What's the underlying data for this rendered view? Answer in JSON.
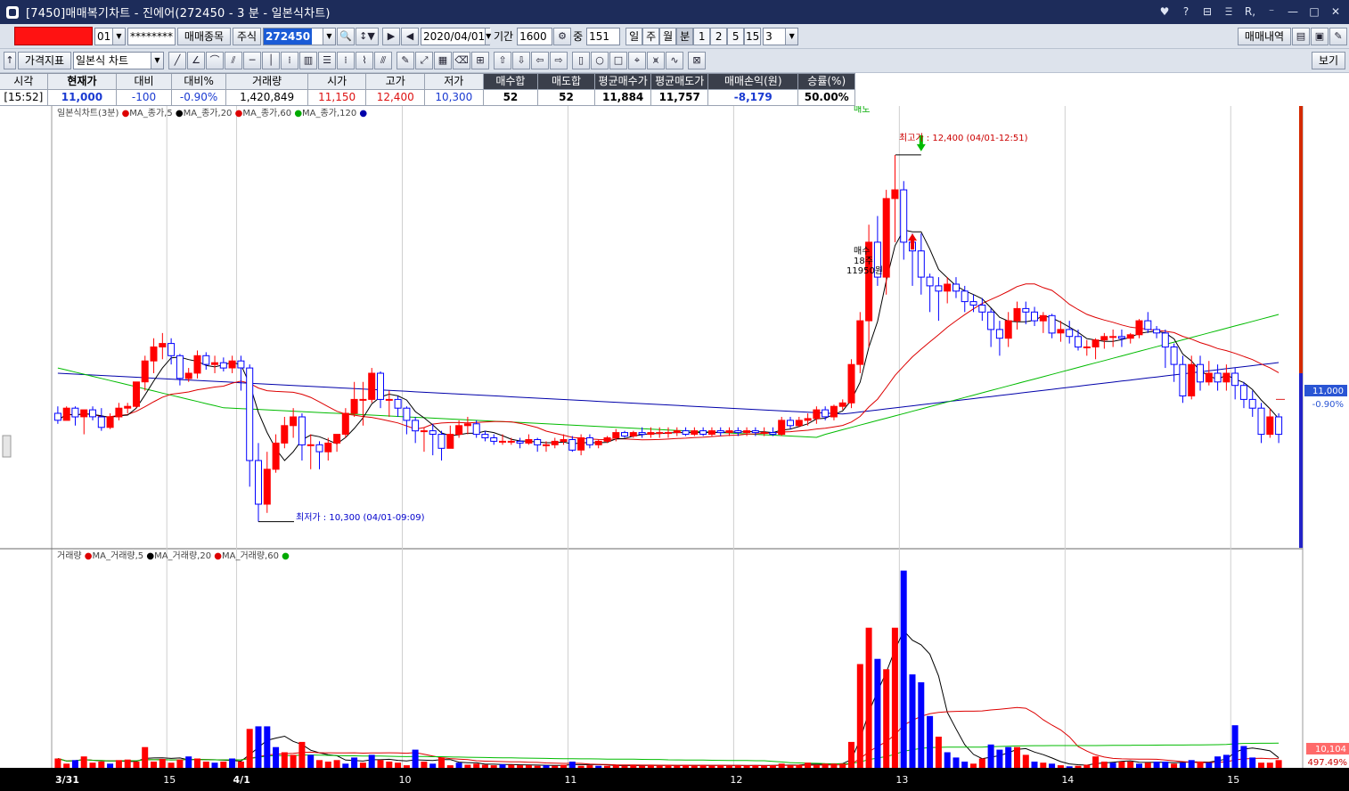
{
  "window": {
    "title": "[7450]매매복기차트 - 진에어(272450 - 3 분 - 일본식차트)",
    "controls": [
      "♥",
      "?",
      "⊟",
      "Ⲷ",
      "R,",
      "⁻",
      "—",
      "□",
      "✕"
    ]
  },
  "toolbar1": {
    "account_num": "01",
    "password": "********",
    "trade_items_label": "매매종목",
    "market_label": "주식",
    "code_value": "272450",
    "date_value": "2020/04/01",
    "period_label": "기간",
    "period_value": "1600",
    "mid_label": "중",
    "count_value": "151",
    "periods": [
      "일",
      "주",
      "월",
      "분",
      "1",
      "2",
      "5",
      "15",
      "3"
    ],
    "trade_history_label": "매매내역"
  },
  "toolbar2": {
    "price_indicator_label": "가격지표",
    "chart_type_value": "일본식 차트",
    "view_label": "보기"
  },
  "info": {
    "headers": [
      "시각",
      "현재가",
      "대비",
      "대비%",
      "거래량",
      "시가",
      "고가",
      "저가",
      "매수합",
      "매도합",
      "평균매수가",
      "평균매도가",
      "매매손익(원)",
      "승률(%)"
    ],
    "values": [
      "[15:52]",
      "11,000",
      "-100",
      "-0.90%",
      "1,420,849",
      "11,150",
      "12,400",
      "10,300",
      "52",
      "52",
      "11,884",
      "11,757",
      "-8,179",
      "50.00%"
    ]
  },
  "colors": {
    "up": "#ff0000",
    "down": "#0000ff",
    "ma5": "#000000",
    "ma20": "#dd0000",
    "ma60": "#00bb00",
    "ma120": "#0000aa",
    "titlebar": "#1d2c5a"
  },
  "chart_data": {
    "type": "candlestick",
    "price_panel": {
      "legend": [
        "일본식차트(3분)",
        "MA_종가,5",
        "MA_종가,20",
        "MA_종가,60",
        "MA_종가,120"
      ],
      "y_range": [
        10150,
        12680
      ],
      "high_annotation": "최고가 : 12,400 (04/01-12:51)",
      "low_annotation": "최저가 : 10,300 (04/01-09:09)",
      "sell_marker": "매도",
      "buy_marker": [
        "매수",
        "18주",
        "11950원"
      ],
      "current_price": "11,000",
      "current_change": "-0.90%",
      "candles": [
        [
          10920,
          10960,
          10860,
          10880
        ],
        [
          10880,
          10960,
          10880,
          10950
        ],
        [
          10950,
          10960,
          10850,
          10900
        ],
        [
          10900,
          10940,
          10800,
          10940
        ],
        [
          10940,
          10960,
          10880,
          10900
        ],
        [
          10900,
          10950,
          10820,
          10840
        ],
        [
          10840,
          10920,
          10830,
          10900
        ],
        [
          10900,
          10980,
          10880,
          10950
        ],
        [
          10950,
          10980,
          10920,
          10960
        ],
        [
          10960,
          11100,
          10950,
          11100
        ],
        [
          11100,
          11250,
          11050,
          11220
        ],
        [
          11220,
          11350,
          11150,
          11300
        ],
        [
          11300,
          11380,
          11230,
          11320
        ],
        [
          11320,
          11350,
          11200,
          11250
        ],
        [
          11250,
          11260,
          11080,
          11120
        ],
        [
          11120,
          11180,
          11100,
          11150
        ],
        [
          11150,
          11280,
          11120,
          11250
        ],
        [
          11250,
          11270,
          11170,
          11200
        ],
        [
          11200,
          11250,
          11150,
          11210
        ],
        [
          11210,
          11240,
          11160,
          11180
        ],
        [
          11180,
          11250,
          11150,
          11220
        ],
        [
          11220,
          11250,
          11050,
          11180
        ],
        [
          11180,
          11200,
          10500,
          10650
        ],
        [
          10650,
          10750,
          10300,
          10400
        ],
        [
          10400,
          10700,
          10350,
          10600
        ],
        [
          10600,
          10800,
          10580,
          10750
        ],
        [
          10750,
          10900,
          10720,
          10850
        ],
        [
          10850,
          10950,
          10780,
          10900
        ],
        [
          10900,
          10920,
          10650,
          10740
        ],
        [
          10740,
          10800,
          10600,
          10740
        ],
        [
          10740,
          10760,
          10600,
          10700
        ],
        [
          10700,
          10780,
          10650,
          10750
        ],
        [
          10750,
          10800,
          10700,
          10800
        ],
        [
          10800,
          10950,
          10780,
          10920
        ],
        [
          10920,
          11100,
          10900,
          11000
        ],
        [
          11000,
          11100,
          10850,
          11000
        ],
        [
          11000,
          11180,
          10980,
          11150
        ],
        [
          11150,
          11160,
          10950,
          11000
        ],
        [
          11000,
          11050,
          10900,
          11000
        ],
        [
          11000,
          11020,
          10900,
          10950
        ],
        [
          10950,
          10960,
          10800,
          10880
        ],
        [
          10880,
          10900,
          10750,
          10820
        ],
        [
          10820,
          10840,
          10700,
          10820
        ],
        [
          10820,
          10860,
          10680,
          10800
        ],
        [
          10800,
          10820,
          10650,
          10720
        ],
        [
          10720,
          10850,
          10720,
          10800
        ],
        [
          10800,
          10880,
          10780,
          10850
        ],
        [
          10850,
          10900,
          10800,
          10860
        ],
        [
          10860,
          10880,
          10780,
          10800
        ],
        [
          10800,
          10820,
          10760,
          10780
        ],
        [
          10780,
          10800,
          10740,
          10760
        ],
        [
          10760,
          10800,
          10740,
          10760
        ],
        [
          10760,
          10780,
          10740,
          10760
        ],
        [
          10760,
          10780,
          10720,
          10750
        ],
        [
          10750,
          10800,
          10740,
          10770
        ],
        [
          10770,
          10780,
          10700,
          10740
        ],
        [
          10740,
          10760,
          10700,
          10740
        ],
        [
          10740,
          10780,
          10720,
          10760
        ],
        [
          10760,
          10800,
          10740,
          10770
        ],
        [
          10770,
          10790,
          10700,
          10710
        ],
        [
          10710,
          10800,
          10680,
          10780
        ],
        [
          10780,
          10800,
          10720,
          10740
        ],
        [
          10740,
          10770,
          10720,
          10760
        ],
        [
          10760,
          10790,
          10750,
          10780
        ],
        [
          10780,
          10830,
          10760,
          10810
        ],
        [
          10810,
          10820,
          10780,
          10790
        ],
        [
          10790,
          10820,
          10780,
          10810
        ],
        [
          10810,
          10840,
          10780,
          10800
        ],
        [
          10800,
          10840,
          10780,
          10810
        ],
        [
          10810,
          10840,
          10780,
          10810
        ],
        [
          10810,
          10840,
          10780,
          10810
        ],
        [
          10810,
          10840,
          10790,
          10820
        ],
        [
          10820,
          10840,
          10790,
          10800
        ],
        [
          10800,
          10840,
          10790,
          10820
        ],
        [
          10820,
          10840,
          10790,
          10800
        ],
        [
          10800,
          10840,
          10790,
          10820
        ],
        [
          10820,
          10840,
          10790,
          10810
        ],
        [
          10810,
          10840,
          10790,
          10820
        ],
        [
          10820,
          10840,
          10790,
          10810
        ],
        [
          10810,
          10840,
          10790,
          10820
        ],
        [
          10820,
          10840,
          10790,
          10810
        ],
        [
          10810,
          10840,
          10790,
          10810
        ],
        [
          10810,
          10840,
          10790,
          10800
        ],
        [
          10800,
          10900,
          10790,
          10880
        ],
        [
          10880,
          10900,
          10830,
          10850
        ],
        [
          10850,
          10900,
          10840,
          10880
        ],
        [
          10880,
          10920,
          10850,
          10890
        ],
        [
          10890,
          10960,
          10860,
          10940
        ],
        [
          10940,
          10960,
          10880,
          10900
        ],
        [
          10900,
          10970,
          10880,
          10960
        ],
        [
          10960,
          11000,
          10940,
          10980
        ],
        [
          10980,
          11230,
          10950,
          11200
        ],
        [
          11200,
          11500,
          11150,
          11450
        ],
        [
          11450,
          12000,
          11300,
          11900
        ],
        [
          11900,
          12050,
          11650,
          11700
        ],
        [
          11700,
          12200,
          11600,
          12150
        ],
        [
          12150,
          12400,
          11900,
          12200
        ],
        [
          12200,
          12250,
          11800,
          11900
        ],
        [
          11900,
          11950,
          11650,
          11850
        ],
        [
          11850,
          11950,
          11600,
          11700
        ],
        [
          11700,
          11720,
          11500,
          11650
        ],
        [
          11650,
          11700,
          11450,
          11620
        ],
        [
          11620,
          11700,
          11550,
          11660
        ],
        [
          11660,
          11700,
          11580,
          11620
        ],
        [
          11620,
          11650,
          11500,
          11560
        ],
        [
          11560,
          11600,
          11500,
          11540
        ],
        [
          11540,
          11580,
          11450,
          11500
        ],
        [
          11500,
          11520,
          11300,
          11400
        ],
        [
          11400,
          11450,
          11250,
          11350
        ],
        [
          11350,
          11500,
          11300,
          11450
        ],
        [
          11450,
          11560,
          11400,
          11520
        ],
        [
          11520,
          11560,
          11430,
          11500
        ],
        [
          11500,
          11530,
          11420,
          11450
        ],
        [
          11450,
          11500,
          11380,
          11480
        ],
        [
          11480,
          11490,
          11350,
          11380
        ],
        [
          11380,
          11450,
          11330,
          11400
        ],
        [
          11400,
          11450,
          11320,
          11360
        ],
        [
          11360,
          11400,
          11280,
          11300
        ],
        [
          11300,
          11340,
          11250,
          11300
        ],
        [
          11300,
          11350,
          11230,
          11340
        ],
        [
          11340,
          11380,
          11290,
          11360
        ],
        [
          11360,
          11400,
          11300,
          11360
        ],
        [
          11360,
          11400,
          11300,
          11350
        ],
        [
          11350,
          11380,
          11320,
          11370
        ],
        [
          11370,
          11460,
          11350,
          11450
        ],
        [
          11450,
          11500,
          11380,
          11400
        ],
        [
          11400,
          11420,
          11350,
          11380
        ],
        [
          11380,
          11400,
          11180,
          11300
        ],
        [
          11300,
          11320,
          11100,
          11200
        ],
        [
          11200,
          11250,
          10980,
          11020
        ],
        [
          11020,
          11250,
          11000,
          11200
        ],
        [
          11200,
          11250,
          11050,
          11100
        ],
        [
          11100,
          11220,
          11080,
          11150
        ],
        [
          11150,
          11200,
          11050,
          11100
        ],
        [
          11100,
          11200,
          11050,
          11150
        ],
        [
          11150,
          11180,
          11000,
          11080
        ],
        [
          11080,
          11100,
          10950,
          11000
        ],
        [
          11000,
          11050,
          10900,
          10950
        ],
        [
          10950,
          10980,
          10750,
          10800
        ],
        [
          10800,
          10950,
          10780,
          10900
        ],
        [
          10900,
          10920,
          10750,
          10800
        ]
      ]
    },
    "volume_panel": {
      "legend": [
        "거래량",
        "MA_거래량,5",
        "MA_거래량,20",
        "MA_거래량,60"
      ],
      "max": 400000,
      "current_volume": "10,104",
      "current_ratio": "497.49%",
      "volumes": [
        18000,
        8000,
        15000,
        22000,
        10000,
        12000,
        8000,
        15000,
        16000,
        12000,
        40000,
        12000,
        17000,
        10000,
        16000,
        22000,
        18000,
        12000,
        10000,
        12000,
        18000,
        12000,
        75000,
        80000,
        80000,
        40000,
        30000,
        25000,
        50000,
        25000,
        15000,
        12000,
        15000,
        8000,
        20000,
        10000,
        25000,
        15000,
        12000,
        10000,
        5000,
        35000,
        12000,
        8000,
        20000,
        5000,
        10000,
        6000,
        8000,
        6000,
        5000,
        7000,
        6000,
        5000,
        5000,
        4000,
        5000,
        4000,
        6000,
        12000,
        4000,
        5000,
        4000,
        4000,
        5000,
        4000,
        5000,
        4000,
        5000,
        4000,
        5000,
        4000,
        5000,
        4000,
        5000,
        4000,
        5000,
        4000,
        5000,
        4000,
        5000,
        4000,
        5000,
        8000,
        5000,
        6000,
        10000,
        6000,
        8000,
        8000,
        8000,
        50000,
        200000,
        270000,
        210000,
        190000,
        270000,
        380000,
        180000,
        165000,
        100000,
        60000,
        30000,
        20000,
        12000,
        8000,
        18000,
        45000,
        35000,
        40000,
        40000,
        25000,
        12000,
        10000,
        8000,
        5000,
        3000,
        4000,
        6000,
        22000,
        12000,
        10000,
        12000,
        12000,
        8000,
        10000,
        12000,
        12000,
        8000,
        10000,
        15000,
        12000,
        10000,
        22000,
        25000,
        82000,
        42000,
        20000,
        10000,
        10000,
        15000,
        12000,
        12000,
        10000,
        20000,
        12000,
        10000,
        22000,
        18000,
        15000,
        25000,
        10000
      ],
      "volume_dir": [
        1,
        1,
        0,
        1,
        1,
        1,
        0,
        1,
        1,
        1,
        1,
        1,
        1,
        1,
        1,
        0,
        1,
        1,
        0,
        1,
        0,
        1,
        1,
        0,
        0,
        0,
        1,
        1,
        1,
        0,
        1,
        1,
        1,
        0,
        0,
        1,
        0,
        1,
        1,
        1,
        1,
        0,
        1,
        0,
        1,
        1,
        0,
        1,
        1,
        1,
        1,
        0,
        1,
        1,
        1,
        1,
        0,
        1,
        1,
        0,
        1,
        1,
        0,
        1,
        1,
        1,
        1,
        1,
        1,
        1,
        1,
        1,
        1,
        1,
        1,
        1,
        1,
        1,
        1,
        1,
        1,
        1,
        1,
        1,
        1,
        1,
        1,
        1,
        1,
        1,
        1,
        1,
        1,
        1,
        0,
        1,
        1,
        0,
        0,
        0,
        0,
        1,
        0,
        0,
        0,
        1,
        1,
        0,
        0,
        0,
        1,
        1,
        0,
        1,
        0,
        1,
        0,
        1,
        1,
        1,
        1,
        0,
        1,
        1,
        0,
        1,
        0,
        0,
        1,
        0,
        0,
        1,
        0,
        0,
        0,
        0,
        0,
        0,
        1,
        1,
        1,
        0,
        1,
        1,
        0,
        1,
        1,
        1,
        1,
        1,
        1,
        0,
        0,
        1,
        0,
        1,
        1,
        0,
        0,
        1
      ]
    },
    "x_ticks": [
      {
        "label": "3/31",
        "i": 0
      },
      {
        "label": "15",
        "i": 13
      },
      {
        "label": "4/1",
        "i": 21
      },
      {
        "label": "10",
        "i": 40
      },
      {
        "label": "11",
        "i": 59
      },
      {
        "label": "12",
        "i": 78
      },
      {
        "label": "13",
        "i": 97
      },
      {
        "label": "14",
        "i": 116
      },
      {
        "label": "15",
        "i": 135
      }
    ]
  }
}
